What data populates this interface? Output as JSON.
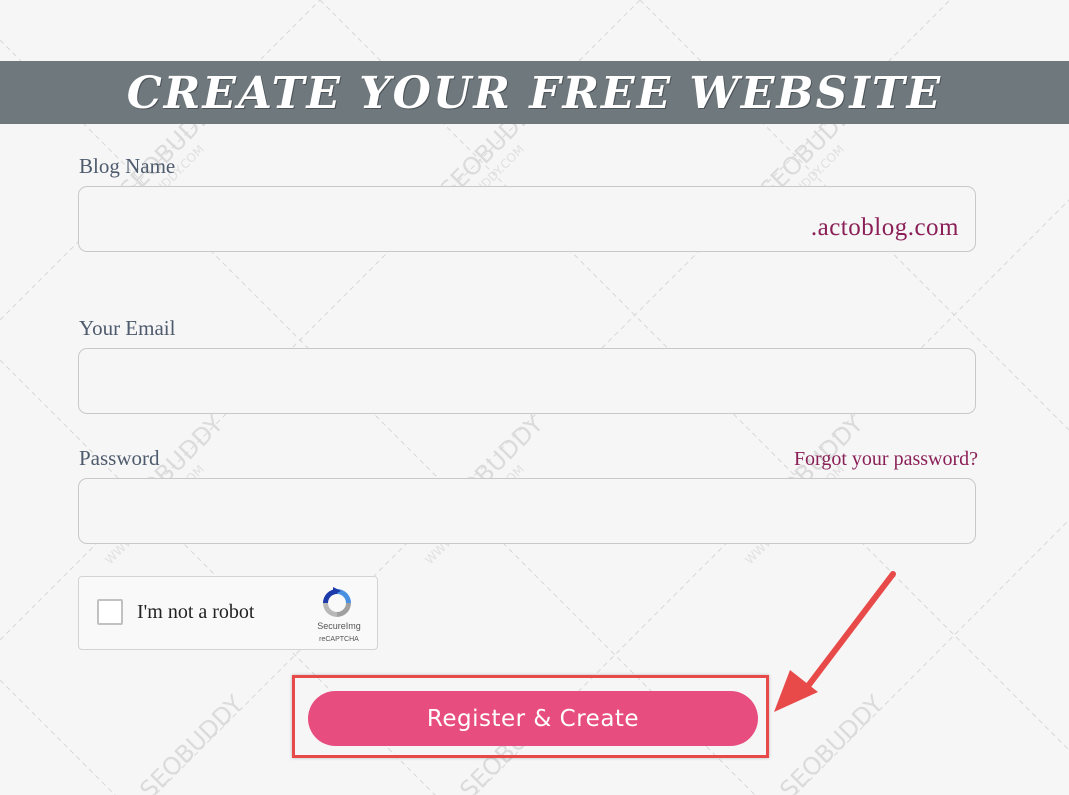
{
  "banner": {
    "title": "CREATE YOUR FREE WEBSITE"
  },
  "form": {
    "blog_name": {
      "label": "Blog Name",
      "value": "",
      "suffix": ".actoblog.com"
    },
    "email": {
      "label": "Your Email",
      "value": ""
    },
    "password": {
      "label": "Password",
      "value": "",
      "forgot_link": "Forgot your password?"
    },
    "captcha": {
      "checked": false,
      "label": "I'm not a robot",
      "brand": "SecureImg",
      "sub": "reCAPTCHA"
    },
    "submit": {
      "label": "Register & Create"
    }
  },
  "watermark": {
    "brand": "SEOBUDDY",
    "url": "WWW.SEOBUDDY.COM"
  },
  "colors": {
    "banner_bg": "#6f787d",
    "accent_link": "#8a2057",
    "button_bg": "#e84d80",
    "annotation_red": "#e84a4a",
    "page_bg": "#f6f6f6"
  },
  "icons": {
    "captcha_logo": "recaptcha-logo-icon",
    "annotation_arrow": "arrow-icon"
  }
}
